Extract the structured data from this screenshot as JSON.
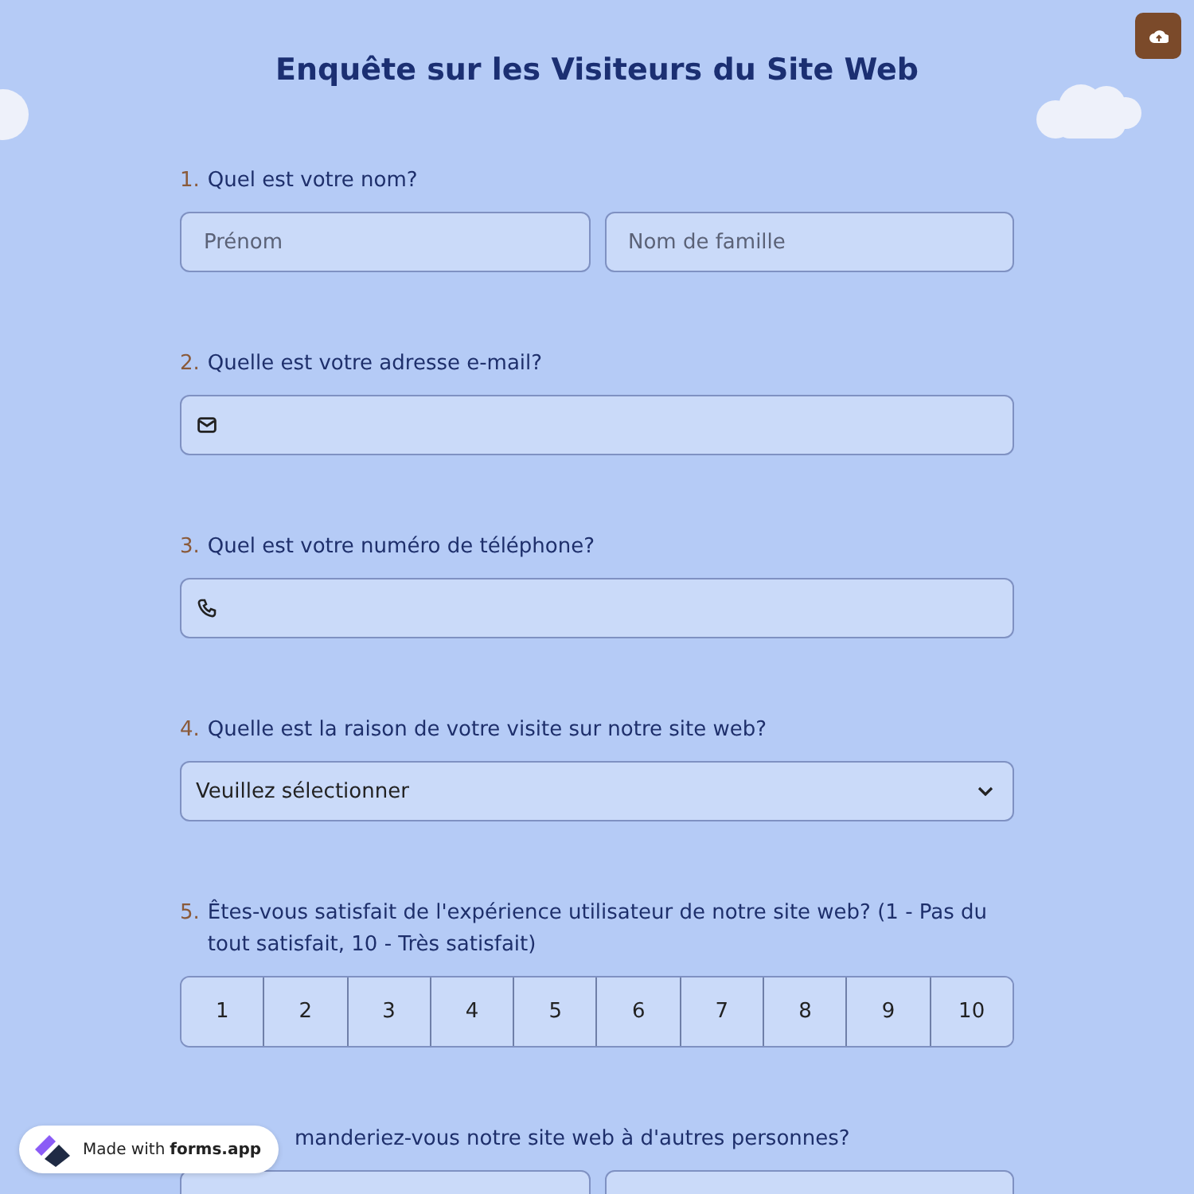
{
  "title": "Enquête sur les Visiteurs du Site Web",
  "questions": [
    {
      "number": "1.",
      "label": "Quel est votre nom?",
      "kind": "name",
      "fields": [
        {
          "placeholder": "Prénom"
        },
        {
          "placeholder": "Nom de famille"
        }
      ]
    },
    {
      "number": "2.",
      "label": "Quelle est votre adresse e-mail?",
      "kind": "email"
    },
    {
      "number": "3.",
      "label": "Quel est votre numéro de téléphone?",
      "kind": "phone"
    },
    {
      "number": "4.",
      "label": "Quelle est la raison de votre visite sur notre site web?",
      "kind": "select",
      "value": "Veuillez sélectionner"
    },
    {
      "number": "5.",
      "label": "Êtes-vous satisfait de l'expérience utilisateur de notre site web? (1 - Pas du tout satisfait, 10 - Très satisfait)",
      "kind": "scale",
      "options": [
        {
          "label": "1",
          "selected": false
        },
        {
          "label": "2",
          "selected": false
        },
        {
          "label": "3",
          "selected": false
        },
        {
          "label": "4",
          "selected": false
        },
        {
          "label": "5",
          "selected": false
        },
        {
          "label": "6",
          "selected": false
        },
        {
          "label": "7",
          "selected": false
        },
        {
          "label": "8",
          "selected": false
        },
        {
          "label": "9",
          "selected": false
        },
        {
          "label": "10",
          "selected": false
        }
      ]
    },
    {
      "label": "manderiez-vous notre site web à d'autres personnes?",
      "kind": "choice",
      "options": [
        {
          "kind": "field"
        },
        {
          "kind": "field"
        }
      ]
    }
  ],
  "badge": {
    "prefix": "Made with",
    "brand": "forms.app"
  }
}
